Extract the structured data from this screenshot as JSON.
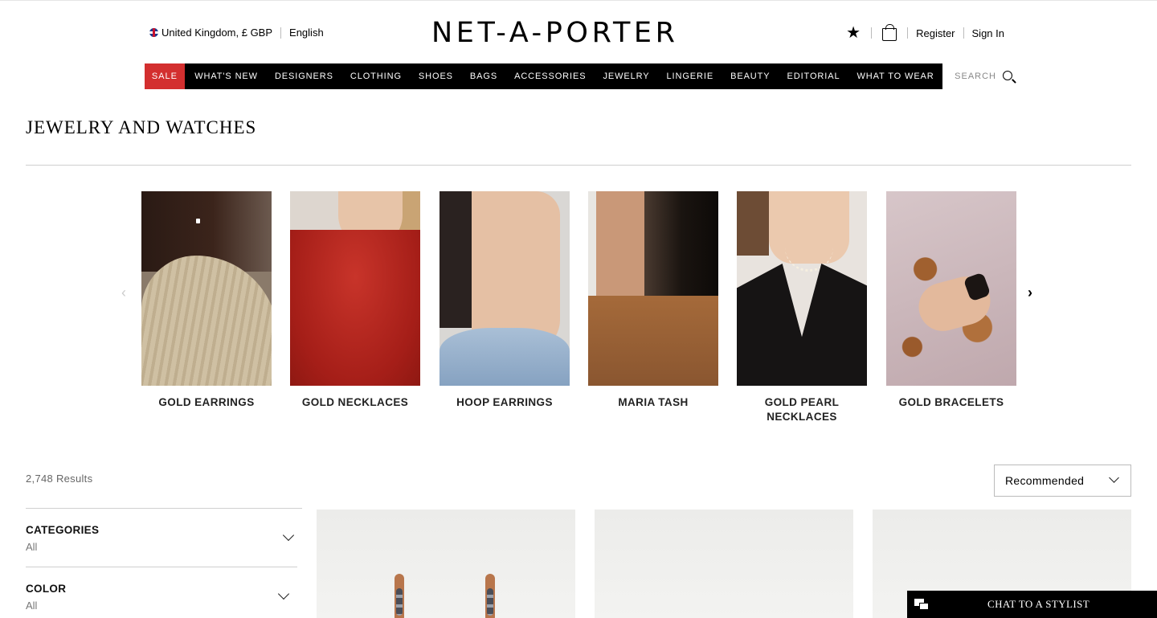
{
  "header": {
    "locale": "United Kingdom, £ GBP",
    "language": "English",
    "logo": "NET-A-PORTER",
    "register": "Register",
    "sign_in": "Sign In",
    "icons": [
      "flag-uk-icon",
      "star-icon",
      "bag-icon"
    ]
  },
  "nav": {
    "sale": "SALE",
    "items": [
      "WHAT'S NEW",
      "DESIGNERS",
      "CLOTHING",
      "SHOES",
      "BAGS",
      "ACCESSORIES",
      "JEWELRY",
      "LINGERIE",
      "BEAUTY",
      "EDITORIAL",
      "WHAT TO WEAR"
    ],
    "search_label": "SEARCH",
    "sale_color": "#d32f2f"
  },
  "page": {
    "title": "JEWELRY AND WATCHES"
  },
  "carousel": {
    "tiles": [
      {
        "label": "GOLD EARRINGS"
      },
      {
        "label": "GOLD NECKLACES"
      },
      {
        "label": "HOOP EARRINGS"
      },
      {
        "label": "MARIA TASH"
      },
      {
        "label": "GOLD PEARL NECKLACES"
      },
      {
        "label": "GOLD BRACELETS"
      }
    ]
  },
  "listing": {
    "results": "2,748 Results",
    "sort_selected": "Recommended",
    "filters": [
      {
        "title": "CATEGORIES",
        "value": "All"
      },
      {
        "title": "COLOR",
        "value": "All"
      }
    ]
  },
  "chat": {
    "label": "CHAT TO A STYLIST"
  }
}
